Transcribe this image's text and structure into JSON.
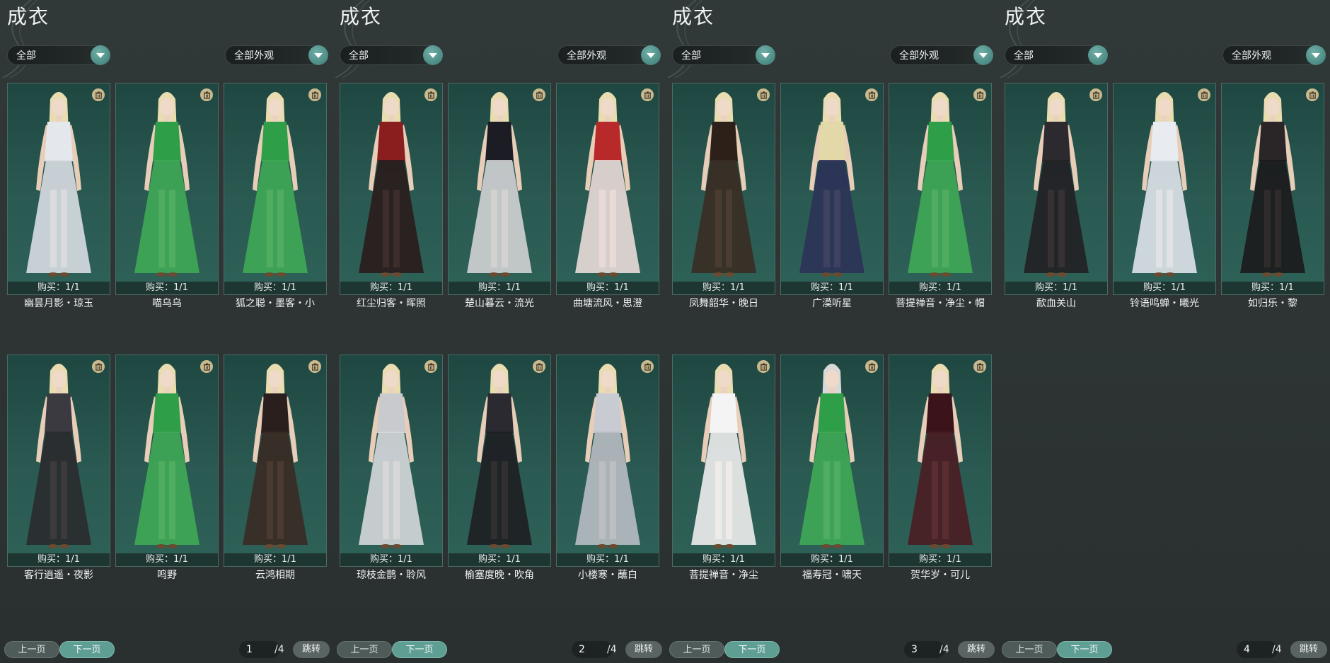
{
  "panels": [
    {
      "title": "成衣",
      "filter_left": "全部",
      "filter_right": "全部外观",
      "items": [
        {
          "name": "幽昙月影・琼玉",
          "buy": "购买：1/1",
          "dress": "#d8dde2",
          "top": "#e4e8ec",
          "hair": "#e8dcb0"
        },
        {
          "name": "喵乌乌",
          "buy": "购买：1/1",
          "dress": "#3faa55",
          "top": "#2f9e48",
          "hair": "#e8dcb0"
        },
        {
          "name": "狐之聪・墨客・小",
          "buy": "购买：1/1",
          "dress": "#3faa55",
          "top": "#2f9e48",
          "hair": "#e8dcb0"
        },
        {
          "name": "客行逍遥・夜影",
          "buy": "购买：1/1",
          "dress": "#2a2a2e",
          "top": "#3a3a40",
          "hair": "#e8dcb0"
        },
        {
          "name": "鸣野",
          "buy": "购买：1/1",
          "dress": "#3faa55",
          "top": "#2f9e48",
          "hair": "#e8dcb0"
        },
        {
          "name": "云鸿相期",
          "buy": "购买：1/1",
          "dress": "#3a2a24",
          "top": "#2a1f1c",
          "hair": "#e8dcb0"
        }
      ],
      "page_current": "1",
      "page_total": "/4",
      "prev": "上一页",
      "next": "下一页",
      "jump": "跳转"
    },
    {
      "title": "成衣",
      "filter_left": "全部",
      "filter_right": "全部外观",
      "items": [
        {
          "name": "红尘归客・晖照",
          "buy": "购买：1/1",
          "dress": "#2a1c1c",
          "top": "#8a1d1d",
          "hair": "#e8dcb0"
        },
        {
          "name": "楚山暮云・流光",
          "buy": "购买：1/1",
          "dress": "#d2d2d4",
          "top": "#1c1c24",
          "hair": "#e8dcb0"
        },
        {
          "name": "曲塘流风・思澄",
          "buy": "购买：1/1",
          "dress": "#eadcd8",
          "top": "#b82a2a",
          "hair": "#e8dcb0"
        },
        {
          "name": "琼枝金鹊・聆风",
          "buy": "购买：1/1",
          "dress": "#d6d8dc",
          "top": "#c8cacd",
          "hair": "#e8dcb0"
        },
        {
          "name": "榆塞度晚・吹角",
          "buy": "购买：1/1",
          "dress": "#1e1e22",
          "top": "#2a2a30",
          "hair": "#e8dcb0"
        },
        {
          "name": "小楼寒・蘸白",
          "buy": "购买：1/1",
          "dress": "#b8bcc2",
          "top": "#c8ccd2",
          "hair": "#e8dcb0"
        }
      ],
      "page_current": "2",
      "page_total": "/4",
      "prev": "上一页",
      "next": "下一页",
      "jump": "跳转"
    },
    {
      "title": "成衣",
      "filter_left": "全部",
      "filter_right": "全部外观",
      "items": [
        {
          "name": "凤舞韶华・晚日",
          "buy": "购买：1/1",
          "dress": "#3a2c22",
          "top": "#2c2019",
          "hair": "#e8dcb0"
        },
        {
          "name": "广漠听星",
          "buy": "购买：1/1",
          "dress": "#2c3258",
          "top": "#e2d8a8",
          "hair": "#e8dcb0"
        },
        {
          "name": "菩提禅音・净尘・帽",
          "buy": "购买：1/1",
          "dress": "#3faa55",
          "top": "#2f9e48",
          "hair": "#e8dcb0"
        },
        {
          "name": "菩提禅音・净尘",
          "buy": "购买：1/1",
          "dress": "#eeeeee",
          "top": "#f4f4f4",
          "hair": "#e8dcb0"
        },
        {
          "name": "福寿冠・啸天",
          "buy": "购买：1/1",
          "dress": "#3faa55",
          "top": "#2f9e48",
          "hair": "#d8d8d8"
        },
        {
          "name": "贺华岁・可儿",
          "buy": "购买：1/1",
          "dress": "#4a1c22",
          "top": "#3a141a",
          "hair": "#e8dcb0"
        }
      ],
      "page_current": "3",
      "page_total": "/4",
      "prev": "上一页",
      "next": "下一页",
      "jump": "跳转"
    },
    {
      "title": "成衣",
      "filter_left": "全部",
      "filter_right": "全部外观",
      "items": [
        {
          "name": "歃血关山",
          "buy": "购买：1/1",
          "dress": "#222024",
          "top": "#2c2a2e",
          "hair": "#e8dcb0"
        },
        {
          "name": "铃语鸣蝉・曦光",
          "buy": "购买：1/1",
          "dress": "#dfe4ea",
          "top": "#e8ecf0",
          "hair": "#e8dcb0"
        },
        {
          "name": "如归乐・黎",
          "buy": "购买：1/1",
          "dress": "#1c1a1c",
          "top": "#2a2628",
          "hair": "#e8dcb0"
        }
      ],
      "page_current": "4",
      "page_total": "/4",
      "prev": "上一页",
      "next": "下一页",
      "jump": "跳转"
    }
  ]
}
